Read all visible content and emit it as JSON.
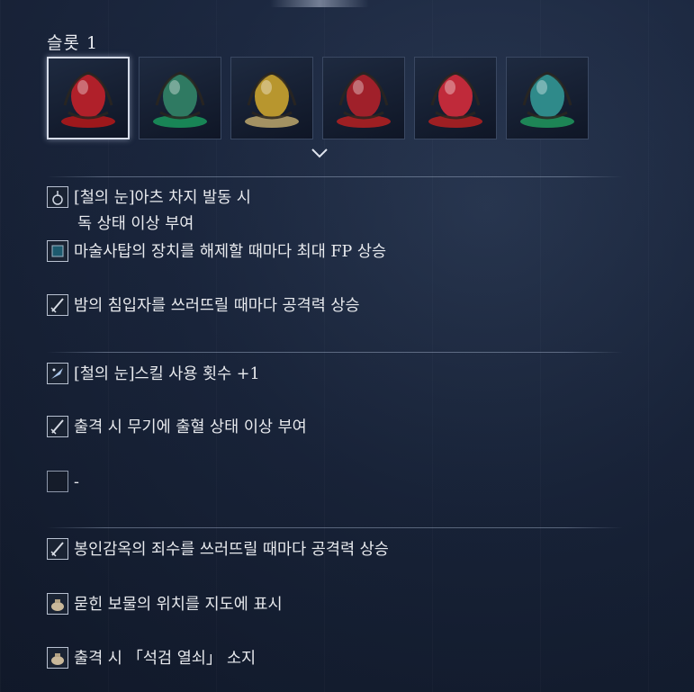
{
  "slot_panel": {
    "title": "슬롯 1",
    "relics": [
      {
        "icon": "red-egg-relic-icon",
        "color": "#b0202a",
        "base": "#c01818",
        "selected": true
      },
      {
        "icon": "green-egg-relic-icon",
        "color": "#2f7a62",
        "base": "#1aa060",
        "selected": false
      },
      {
        "icon": "yellow-egg-relic-icon",
        "color": "#b8962e",
        "base": "#c8b070",
        "selected": false
      },
      {
        "icon": "red-blue-egg-relic-icon",
        "color": "#a0202a",
        "base": "#c02020",
        "selected": false
      },
      {
        "icon": "red-blue-egg-relic-icon",
        "color": "#c02a3a",
        "base": "#c02020",
        "selected": false
      },
      {
        "icon": "teal-egg-relic-icon",
        "color": "#2f8a8a",
        "base": "#20a060",
        "selected": false
      }
    ],
    "expand_icon": "chevron-down-icon"
  },
  "effects": [
    {
      "icon": "rune-skill-icon",
      "text": "[철의 눈]아츠 차지 발동 시",
      "subtext": "독 상태 이상 부여"
    },
    {
      "icon": "square-fp-icon",
      "text": "마술사탑의 장치를 해제할 때마다 최대 FP 상승"
    },
    {
      "icon": "sword-icon",
      "text": "밤의 침입자를 쓰러뜨릴 때마다 공격력 상승"
    },
    {
      "icon": "skill-feather-icon",
      "text": "[철의 눈]스킬 사용 횟수 +1"
    },
    {
      "icon": "sword-icon",
      "text": "출격 시 무기에 출혈 상태 이상 부여"
    },
    {
      "icon": "empty-slot-icon",
      "text": "-"
    },
    {
      "icon": "sword-icon",
      "text": "봉인감옥의 죄수를 쓰러뜨릴 때마다 공격력 상승"
    },
    {
      "icon": "pouch-icon",
      "text": "묻힌 보물의 위치를 지도에 표시"
    },
    {
      "icon": "pouch-icon",
      "text": "출격 시 「석검 열쇠」 소지"
    }
  ]
}
